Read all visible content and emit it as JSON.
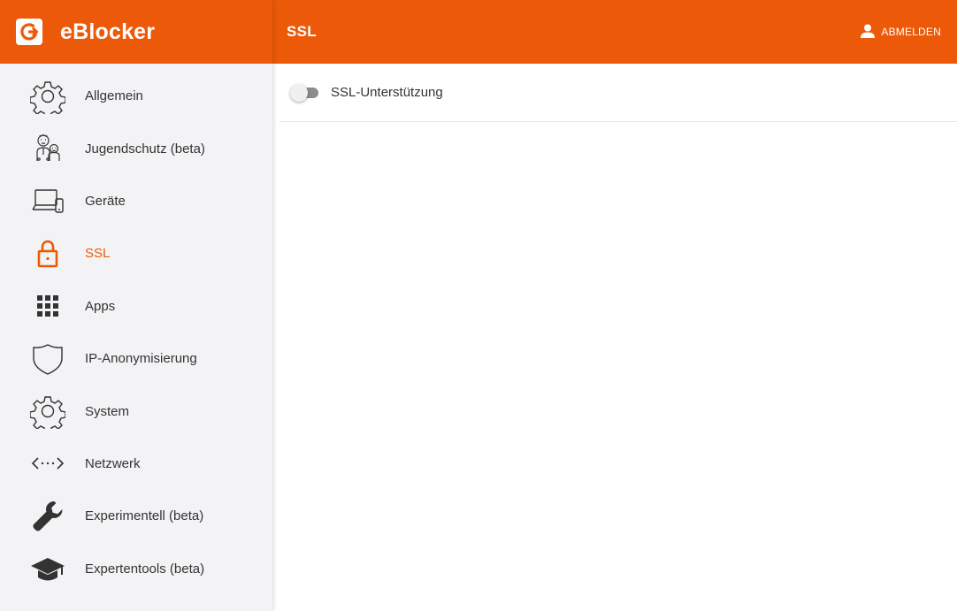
{
  "brand": {
    "name": "eBlocker",
    "logo_icon": "eblocker-logo-icon"
  },
  "header": {
    "title": "SSL",
    "logout_label": "ABMELDEN",
    "logout_icon": "user-icon"
  },
  "sidebar": {
    "items": [
      {
        "label": "Allgemein",
        "icon": "gear-icon",
        "active": false
      },
      {
        "label": "Jugendschutz (beta)",
        "icon": "family-icon",
        "active": false
      },
      {
        "label": "Geräte",
        "icon": "devices-icon",
        "active": false
      },
      {
        "label": "SSL",
        "icon": "lock-icon",
        "active": true
      },
      {
        "label": "Apps",
        "icon": "apps-grid-icon",
        "active": false
      },
      {
        "label": "IP-Anonymisierung",
        "icon": "shield-icon",
        "active": false
      },
      {
        "label": "System",
        "icon": "gear-icon",
        "active": false
      },
      {
        "label": "Netzwerk",
        "icon": "network-icon",
        "active": false
      },
      {
        "label": "Experimentell (beta)",
        "icon": "wrench-icon",
        "active": false
      },
      {
        "label": "Expertentools (beta)",
        "icon": "graduation-cap-icon",
        "active": false
      }
    ]
  },
  "main": {
    "ssl_toggle": {
      "label": "SSL-Unterstützung",
      "enabled": false
    }
  },
  "colors": {
    "accent": "#ec5a09",
    "sidebar_bg": "#f3f3f5",
    "text": "#333333"
  }
}
